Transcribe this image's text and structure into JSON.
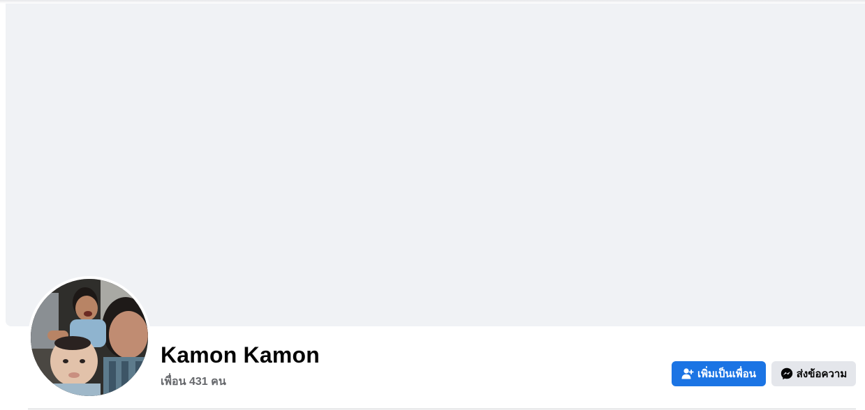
{
  "profile": {
    "name": "Kamon Kamon",
    "friends_text": "เพื่อน 431 คน"
  },
  "actions": {
    "add_friend_label": "เพิ่มเป็นเพื่อน",
    "add_friend_icon": "add-friend-icon",
    "message_label": "ส่งข้อความ",
    "message_icon": "messenger-icon"
  },
  "colors": {
    "primary_button": "#1b74e4",
    "secondary_button": "#e4e6eb",
    "cover_background": "#f0f2f5",
    "secondary_text": "#65676b"
  }
}
